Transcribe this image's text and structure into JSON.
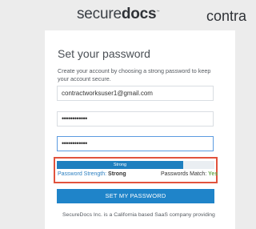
{
  "brand": {
    "logo_light": "secure",
    "logo_bold": "docs",
    "logo_mark": "™",
    "cobrand": "contra"
  },
  "page": {
    "title": "Set your password",
    "description": "Create your account by choosing a strong password to keep your account secure."
  },
  "form": {
    "email_value": "contractworksuser1@gmail.com",
    "password_value": "••••••••••••",
    "confirm_password_value": "••••••••••••"
  },
  "strength": {
    "meter_label": "Strong",
    "meter_level": 0.8,
    "strength_label": "Password Strength:",
    "strength_value": "Strong",
    "match_label": "Passwords Match:",
    "match_value": "Yes",
    "colors": {
      "meter_fill": "#1e7fbf",
      "highlight_border": "#e1533d",
      "match_ok": "#6aa84f"
    }
  },
  "actions": {
    "submit_label": "SET MY PASSWORD"
  },
  "footer": {
    "text": "SecureDocs Inc. is a California based SaaS company providing"
  }
}
